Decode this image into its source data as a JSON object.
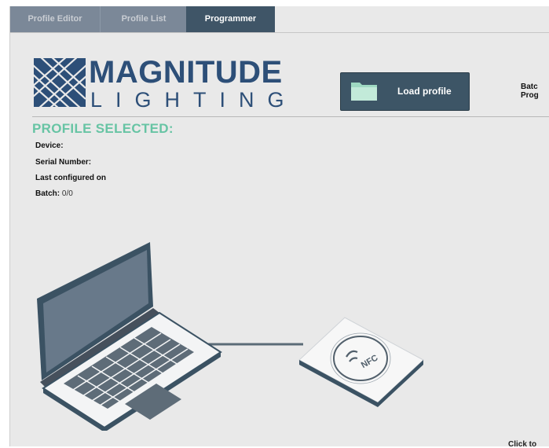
{
  "tabs": [
    {
      "label": "Profile Editor",
      "active": false
    },
    {
      "label": "Profile List",
      "active": false
    },
    {
      "label": "Programmer",
      "active": true
    }
  ],
  "logo": {
    "line1": "MAGNITUDE",
    "line2": "LIGHTING"
  },
  "load_button": {
    "label": "Load profile",
    "icon": "folder-icon"
  },
  "right_cut_text": {
    "line1": "Batc",
    "line2": "Prog"
  },
  "profile": {
    "section_title": "PROFILE SELECTED:",
    "device_label": "Device:",
    "serial_label": "Serial Number:",
    "last_configured_label": "Last configured on",
    "batch_label": "Batch:",
    "batch_value": "0/0"
  },
  "illustration": {
    "nfc_label": "NFC"
  },
  "bottom_hint": "Click to",
  "colors": {
    "tab_inactive": "#7b8898",
    "tab_active": "#3f5567",
    "accent_green": "#67c4a4",
    "logo_blue": "#2d4f78",
    "button_bg": "#3d5566"
  }
}
